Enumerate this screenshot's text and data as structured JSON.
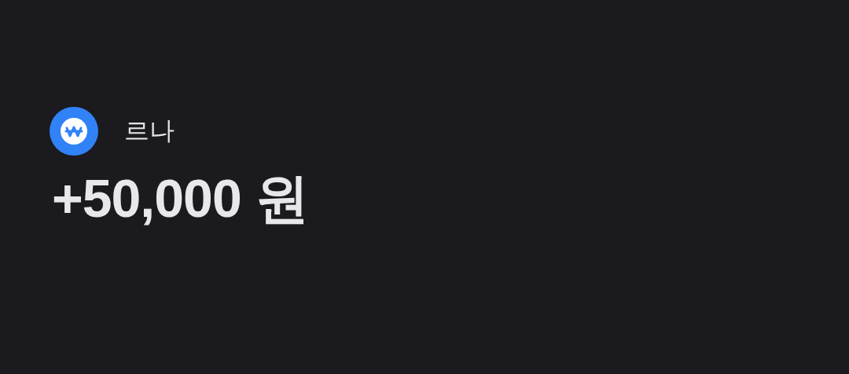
{
  "transaction": {
    "sender": "르나",
    "amount": "+50,000 원"
  }
}
